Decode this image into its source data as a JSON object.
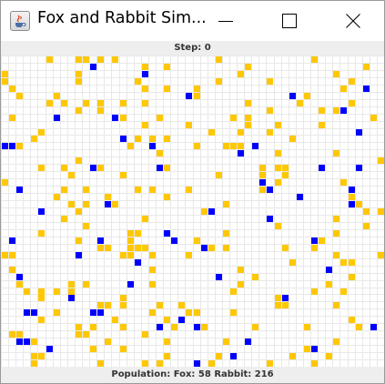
{
  "window": {
    "title": "Fox and Rabbit Sim...",
    "controls": {
      "minimize": "minimize",
      "maximize": "maximize",
      "close": "close"
    }
  },
  "step_label": "Step: 0",
  "population_label": "Population: Fox: 58 Rabbit: 216",
  "colors": {
    "rabbit": "#ffc800",
    "fox": "#0000ff",
    "grid_line": "#e8e8e8",
    "status_bg": "#eeeeee"
  },
  "field": {
    "columns": 52,
    "rows": 43,
    "foxes": [
      [
        12,
        1
      ],
      [
        19,
        2
      ],
      [
        49,
        4
      ],
      [
        25,
        5
      ],
      [
        39,
        5
      ],
      [
        7,
        8
      ],
      [
        15,
        8
      ],
      [
        0,
        12
      ],
      [
        1,
        12
      ],
      [
        16,
        11
      ],
      [
        20,
        12
      ],
      [
        32,
        13
      ],
      [
        12,
        15
      ],
      [
        21,
        15
      ],
      [
        43,
        15
      ],
      [
        48,
        15
      ],
      [
        35,
        17
      ],
      [
        2,
        18
      ],
      [
        36,
        18
      ],
      [
        47,
        18
      ],
      [
        40,
        19
      ],
      [
        47,
        20
      ],
      [
        5,
        21
      ],
      [
        28,
        21
      ],
      [
        1,
        25
      ],
      [
        13,
        25
      ],
      [
        23,
        25
      ],
      [
        42,
        25
      ],
      [
        27,
        26
      ],
      [
        18,
        28
      ],
      [
        2,
        30
      ],
      [
        9,
        33
      ],
      [
        3,
        35
      ],
      [
        4,
        35
      ],
      [
        12,
        35
      ],
      [
        13,
        35
      ],
      [
        21,
        37
      ],
      [
        50,
        37
      ],
      [
        26,
        37
      ],
      [
        2,
        39
      ],
      [
        3,
        39
      ],
      [
        6,
        40
      ],
      [
        42,
        40
      ],
      [
        31,
        41
      ],
      [
        26,
        42
      ],
      [
        36,
        22
      ],
      [
        14,
        20
      ],
      [
        22,
        24
      ],
      [
        34,
        12
      ],
      [
        46,
        7
      ],
      [
        29,
        30
      ],
      [
        10,
        27
      ],
      [
        38,
        33
      ],
      [
        17,
        31
      ],
      [
        44,
        29
      ],
      [
        24,
        36
      ],
      [
        33,
        39
      ],
      [
        48,
        10
      ]
    ]
  }
}
